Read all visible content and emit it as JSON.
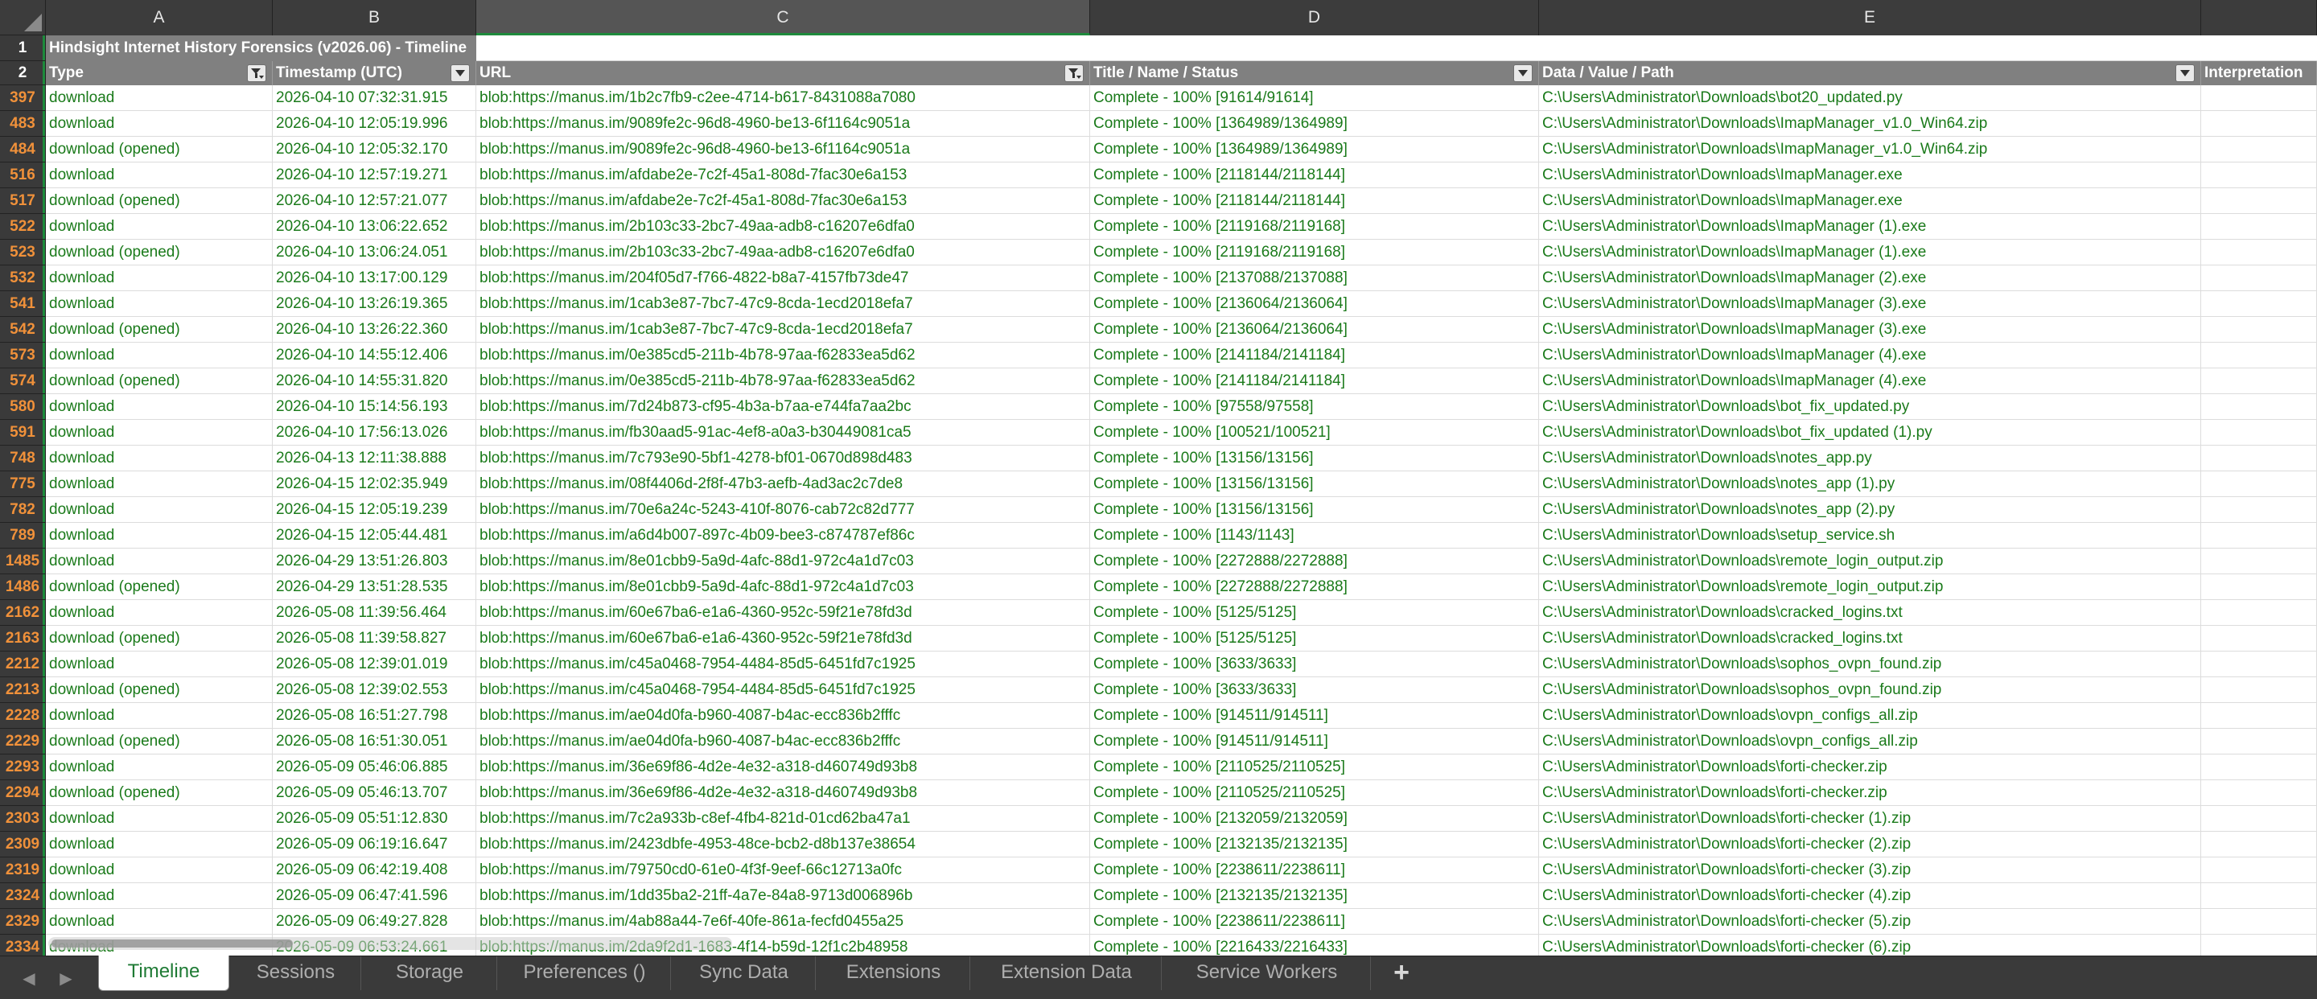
{
  "columns": [
    "A",
    "B",
    "C",
    "D",
    "E"
  ],
  "row1": {
    "rownum": "1",
    "title": "Hindsight Internet History Forensics (v2026.06) - Timeline"
  },
  "row2": {
    "rownum": "2",
    "headers": [
      "Type",
      "Timestamp (UTC)",
      "URL",
      "Title / Name / Status",
      "Data / Value / Path",
      "Interpretation"
    ],
    "filter_active": [
      true,
      false,
      true,
      false,
      false
    ]
  },
  "rows": [
    {
      "n": "397",
      "type": "download",
      "ts": "2026-04-10 07:32:31.915",
      "url": "blob:https://manus.im/1b2c7fb9-c2ee-4714-b617-8431088a7080",
      "title": "Complete - 100% [91614/91614]",
      "path": "C:\\Users\\Administrator\\Downloads\\bot20_updated.py"
    },
    {
      "n": "483",
      "type": "download",
      "ts": "2026-04-10 12:05:19.996",
      "url": "blob:https://manus.im/9089fe2c-96d8-4960-be13-6f1164c9051a",
      "title": "Complete - 100% [1364989/1364989]",
      "path": "C:\\Users\\Administrator\\Downloads\\ImapManager_v1.0_Win64.zip"
    },
    {
      "n": "484",
      "type": "download (opened)",
      "ts": "2026-04-10 12:05:32.170",
      "url": "blob:https://manus.im/9089fe2c-96d8-4960-be13-6f1164c9051a",
      "title": "Complete - 100% [1364989/1364989]",
      "path": "C:\\Users\\Administrator\\Downloads\\ImapManager_v1.0_Win64.zip"
    },
    {
      "n": "516",
      "type": "download",
      "ts": "2026-04-10 12:57:19.271",
      "url": "blob:https://manus.im/afdabe2e-7c2f-45a1-808d-7fac30e6a153",
      "title": "Complete - 100% [2118144/2118144]",
      "path": "C:\\Users\\Administrator\\Downloads\\ImapManager.exe"
    },
    {
      "n": "517",
      "type": "download (opened)",
      "ts": "2026-04-10 12:57:21.077",
      "url": "blob:https://manus.im/afdabe2e-7c2f-45a1-808d-7fac30e6a153",
      "title": "Complete - 100% [2118144/2118144]",
      "path": "C:\\Users\\Administrator\\Downloads\\ImapManager.exe"
    },
    {
      "n": "522",
      "type": "download",
      "ts": "2026-04-10 13:06:22.652",
      "url": "blob:https://manus.im/2b103c33-2bc7-49aa-adb8-c16207e6dfa0",
      "title": "Complete - 100% [2119168/2119168]",
      "path": "C:\\Users\\Administrator\\Downloads\\ImapManager (1).exe"
    },
    {
      "n": "523",
      "type": "download (opened)",
      "ts": "2026-04-10 13:06:24.051",
      "url": "blob:https://manus.im/2b103c33-2bc7-49aa-adb8-c16207e6dfa0",
      "title": "Complete - 100% [2119168/2119168]",
      "path": "C:\\Users\\Administrator\\Downloads\\ImapManager (1).exe"
    },
    {
      "n": "532",
      "type": "download",
      "ts": "2026-04-10 13:17:00.129",
      "url": "blob:https://manus.im/204f05d7-f766-4822-b8a7-4157fb73de47",
      "title": "Complete - 100% [2137088/2137088]",
      "path": "C:\\Users\\Administrator\\Downloads\\ImapManager (2).exe"
    },
    {
      "n": "541",
      "type": "download",
      "ts": "2026-04-10 13:26:19.365",
      "url": "blob:https://manus.im/1cab3e87-7bc7-47c9-8cda-1ecd2018efa7",
      "title": "Complete - 100% [2136064/2136064]",
      "path": "C:\\Users\\Administrator\\Downloads\\ImapManager (3).exe"
    },
    {
      "n": "542",
      "type": "download (opened)",
      "ts": "2026-04-10 13:26:22.360",
      "url": "blob:https://manus.im/1cab3e87-7bc7-47c9-8cda-1ecd2018efa7",
      "title": "Complete - 100% [2136064/2136064]",
      "path": "C:\\Users\\Administrator\\Downloads\\ImapManager (3).exe"
    },
    {
      "n": "573",
      "type": "download",
      "ts": "2026-04-10 14:55:12.406",
      "url": "blob:https://manus.im/0e385cd5-211b-4b78-97aa-f62833ea5d62",
      "title": "Complete - 100% [2141184/2141184]",
      "path": "C:\\Users\\Administrator\\Downloads\\ImapManager (4).exe"
    },
    {
      "n": "574",
      "type": "download (opened)",
      "ts": "2026-04-10 14:55:31.820",
      "url": "blob:https://manus.im/0e385cd5-211b-4b78-97aa-f62833ea5d62",
      "title": "Complete - 100% [2141184/2141184]",
      "path": "C:\\Users\\Administrator\\Downloads\\ImapManager (4).exe"
    },
    {
      "n": "580",
      "type": "download",
      "ts": "2026-04-10 15:14:56.193",
      "url": "blob:https://manus.im/7d24b873-cf95-4b3a-b7aa-e744fa7aa2bc",
      "title": "Complete - 100% [97558/97558]",
      "path": "C:\\Users\\Administrator\\Downloads\\bot_fix_updated.py"
    },
    {
      "n": "591",
      "type": "download",
      "ts": "2026-04-10 17:56:13.026",
      "url": "blob:https://manus.im/fb30aad5-91ac-4ef8-a0a3-b30449081ca5",
      "title": "Complete - 100% [100521/100521]",
      "path": "C:\\Users\\Administrator\\Downloads\\bot_fix_updated (1).py"
    },
    {
      "n": "748",
      "type": "download",
      "ts": "2026-04-13 12:11:38.888",
      "url": "blob:https://manus.im/7c793e90-5bf1-4278-bf01-0670d898d483",
      "title": "Complete - 100% [13156/13156]",
      "path": "C:\\Users\\Administrator\\Downloads\\notes_app.py"
    },
    {
      "n": "775",
      "type": "download",
      "ts": "2026-04-15 12:02:35.949",
      "url": "blob:https://manus.im/08f4406d-2f8f-47b3-aefb-4ad3ac2c7de8",
      "title": "Complete - 100% [13156/13156]",
      "path": "C:\\Users\\Administrator\\Downloads\\notes_app (1).py"
    },
    {
      "n": "782",
      "type": "download",
      "ts": "2026-04-15 12:05:19.239",
      "url": "blob:https://manus.im/70e6a24c-5243-410f-8076-cab72c82d777",
      "title": "Complete - 100% [13156/13156]",
      "path": "C:\\Users\\Administrator\\Downloads\\notes_app (2).py"
    },
    {
      "n": "789",
      "type": "download",
      "ts": "2026-04-15 12:05:44.481",
      "url": "blob:https://manus.im/a6d4b007-897c-4b09-bee3-c874787ef86c",
      "title": "Complete - 100% [1143/1143]",
      "path": "C:\\Users\\Administrator\\Downloads\\setup_service.sh"
    },
    {
      "n": "1485",
      "type": "download",
      "ts": "2026-04-29 13:51:26.803",
      "url": "blob:https://manus.im/8e01cbb9-5a9d-4afc-88d1-972c4a1d7c03",
      "title": "Complete - 100% [2272888/2272888]",
      "path": "C:\\Users\\Administrator\\Downloads\\remote_login_output.zip"
    },
    {
      "n": "1486",
      "type": "download (opened)",
      "ts": "2026-04-29 13:51:28.535",
      "url": "blob:https://manus.im/8e01cbb9-5a9d-4afc-88d1-972c4a1d7c03",
      "title": "Complete - 100% [2272888/2272888]",
      "path": "C:\\Users\\Administrator\\Downloads\\remote_login_output.zip"
    },
    {
      "n": "2162",
      "type": "download",
      "ts": "2026-05-08 11:39:56.464",
      "url": "blob:https://manus.im/60e67ba6-e1a6-4360-952c-59f21e78fd3d",
      "title": "Complete - 100% [5125/5125]",
      "path": "C:\\Users\\Administrator\\Downloads\\cracked_logins.txt"
    },
    {
      "n": "2163",
      "type": "download (opened)",
      "ts": "2026-05-08 11:39:58.827",
      "url": "blob:https://manus.im/60e67ba6-e1a6-4360-952c-59f21e78fd3d",
      "title": "Complete - 100% [5125/5125]",
      "path": "C:\\Users\\Administrator\\Downloads\\cracked_logins.txt"
    },
    {
      "n": "2212",
      "type": "download",
      "ts": "2026-05-08 12:39:01.019",
      "url": "blob:https://manus.im/c45a0468-7954-4484-85d5-6451fd7c1925",
      "title": "Complete - 100% [3633/3633]",
      "path": "C:\\Users\\Administrator\\Downloads\\sophos_ovpn_found.zip"
    },
    {
      "n": "2213",
      "type": "download (opened)",
      "ts": "2026-05-08 12:39:02.553",
      "url": "blob:https://manus.im/c45a0468-7954-4484-85d5-6451fd7c1925",
      "title": "Complete - 100% [3633/3633]",
      "path": "C:\\Users\\Administrator\\Downloads\\sophos_ovpn_found.zip"
    },
    {
      "n": "2228",
      "type": "download",
      "ts": "2026-05-08 16:51:27.798",
      "url": "blob:https://manus.im/ae04d0fa-b960-4087-b4ac-ecc836b2fffc",
      "title": "Complete - 100% [914511/914511]",
      "path": "C:\\Users\\Administrator\\Downloads\\ovpn_configs_all.zip"
    },
    {
      "n": "2229",
      "type": "download (opened)",
      "ts": "2026-05-08 16:51:30.051",
      "url": "blob:https://manus.im/ae04d0fa-b960-4087-b4ac-ecc836b2fffc",
      "title": "Complete - 100% [914511/914511]",
      "path": "C:\\Users\\Administrator\\Downloads\\ovpn_configs_all.zip"
    },
    {
      "n": "2293",
      "type": "download",
      "ts": "2026-05-09 05:46:06.885",
      "url": "blob:https://manus.im/36e69f86-4d2e-4e32-a318-d460749d93b8",
      "title": "Complete - 100% [2110525/2110525]",
      "path": "C:\\Users\\Administrator\\Downloads\\forti-checker.zip"
    },
    {
      "n": "2294",
      "type": "download (opened)",
      "ts": "2026-05-09 05:46:13.707",
      "url": "blob:https://manus.im/36e69f86-4d2e-4e32-a318-d460749d93b8",
      "title": "Complete - 100% [2110525/2110525]",
      "path": "C:\\Users\\Administrator\\Downloads\\forti-checker.zip"
    },
    {
      "n": "2303",
      "type": "download",
      "ts": "2026-05-09 05:51:12.830",
      "url": "blob:https://manus.im/7c2a933b-c8ef-4fb4-821d-01cd62ba47a1",
      "title": "Complete - 100% [2132059/2132059]",
      "path": "C:\\Users\\Administrator\\Downloads\\forti-checker (1).zip"
    },
    {
      "n": "2309",
      "type": "download",
      "ts": "2026-05-09 06:19:16.647",
      "url": "blob:https://manus.im/2423dbfe-4953-48ce-bcb2-d8b137e38654",
      "title": "Complete - 100% [2132135/2132135]",
      "path": "C:\\Users\\Administrator\\Downloads\\forti-checker (2).zip"
    },
    {
      "n": "2319",
      "type": "download",
      "ts": "2026-05-09 06:42:19.408",
      "url": "blob:https://manus.im/79750cd0-61e0-4f3f-9eef-66c12713a0fc",
      "title": "Complete - 100% [2238611/2238611]",
      "path": "C:\\Users\\Administrator\\Downloads\\forti-checker (3).zip"
    },
    {
      "n": "2324",
      "type": "download",
      "ts": "2026-05-09 06:47:41.596",
      "url": "blob:https://manus.im/1dd35ba2-21ff-4a7e-84a8-9713d006896b",
      "title": "Complete - 100% [2132135/2132135]",
      "path": "C:\\Users\\Administrator\\Downloads\\forti-checker (4).zip"
    },
    {
      "n": "2329",
      "type": "download",
      "ts": "2026-05-09 06:49:27.828",
      "url": "blob:https://manus.im/4ab88a44-7e6f-40fe-861a-fecfd0455a25",
      "title": "Complete - 100% [2238611/2238611]",
      "path": "C:\\Users\\Administrator\\Downloads\\forti-checker (5).zip"
    },
    {
      "n": "2334",
      "type": "download",
      "ts": "2026-05-09 06:53:24.661",
      "url": "blob:https://manus.im/2da9f2d1-1683-4f14-b59d-12f1c2b48958",
      "title": "Complete - 100% [2216433/2216433]",
      "path": "C:\\Users\\Administrator\\Downloads\\forti-checker (6).zip"
    }
  ],
  "tabs": [
    "Timeline",
    "Sessions",
    "Storage",
    "Preferences ()",
    "Sync Data",
    "Extensions",
    "Extension Data",
    "Service Workers"
  ],
  "active_tab": "Timeline",
  "icons": {
    "prev": "prev-sheet-icon",
    "next": "next-sheet-icon",
    "add": "add-sheet-icon",
    "filter": "filter-icon"
  },
  "colors": {
    "text_green": "#1a7a1a",
    "row_number_orange": "#f0913a",
    "header_gray": "#808080",
    "active_tab_text": "#1e7a34"
  }
}
